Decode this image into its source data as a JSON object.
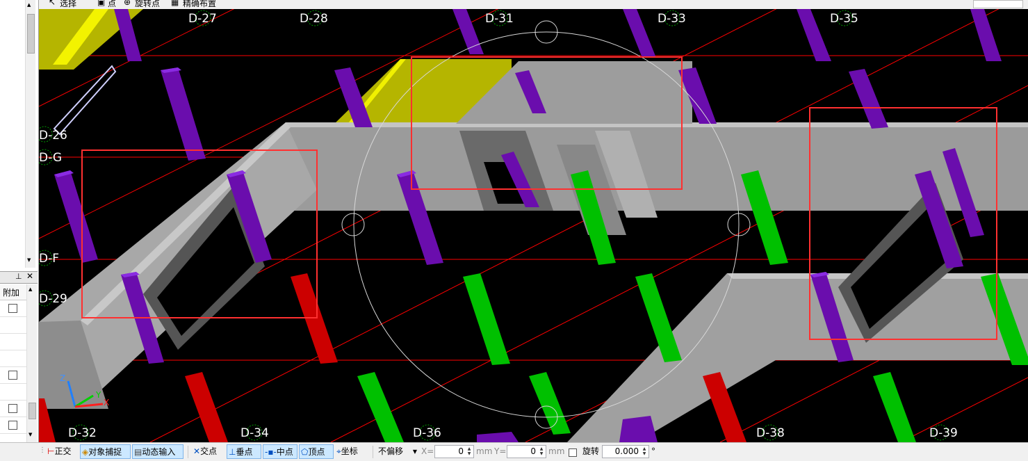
{
  "top_toolbar": {
    "select_label": "选择",
    "point_label": "点",
    "rotate_point_label": "旋转点",
    "precise_layout_label": "精确布置"
  },
  "attr_panel": {
    "pin_icon": "pin-icon",
    "close_icon": "close-icon",
    "column_label": "附加"
  },
  "viewport": {
    "axis_labels_top": [
      "D-27",
      "D-28",
      "D-31",
      "D-33",
      "D-35"
    ],
    "axis_labels_left": [
      "D-26",
      "D-G",
      "D-F",
      "D-29"
    ],
    "axis_labels_bottom": [
      "D-32",
      "D-34",
      "D-36",
      "D-38",
      "D-39"
    ],
    "axes": {
      "x": "X",
      "y": "Y",
      "z": "Z"
    },
    "colors": {
      "background": "#000000",
      "grid_line": "#ff0000",
      "wall": "#a9a9a9",
      "column_purple": "#6a0dad",
      "column_green": "#00c000",
      "column_red": "#cc0000",
      "slab_yellow": "#b5b500",
      "highlight_box": "#ff3030"
    }
  },
  "status_bar": {
    "ortho_label": "正交",
    "snap_label": "对象捕捉",
    "dynamic_input_label": "动态输入",
    "intersection_label": "交点",
    "perpendicular_label": "垂点",
    "midpoint_label": "中点",
    "vertex_label": "顶点",
    "coordinate_label": "坐标",
    "offset_mode": "不偏移",
    "x_label": "X=",
    "x_value": "0",
    "x_unit": "mm",
    "y_label": "Y=",
    "y_value": "0",
    "y_unit": "mm",
    "rotate_label": "旋转",
    "rotate_value": "0.000",
    "degree_symbol": "°"
  }
}
